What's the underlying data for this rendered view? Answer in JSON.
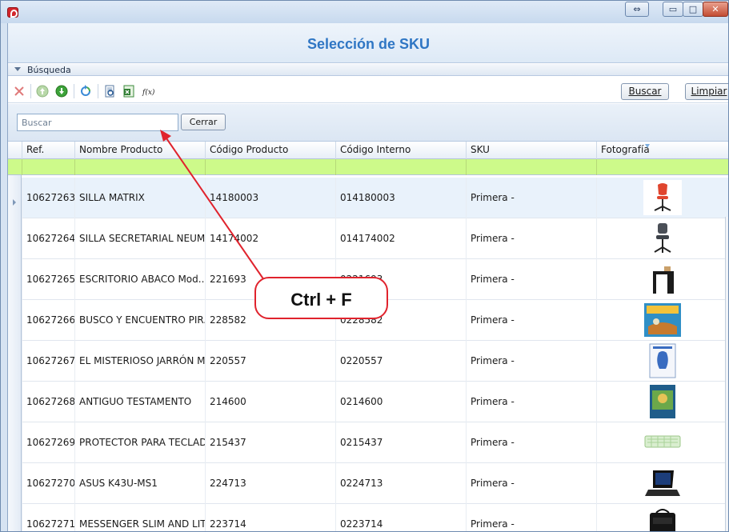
{
  "window": {
    "controls": {
      "restore_side": "⇔",
      "minimize": "▭",
      "maximize": "□",
      "close": "✕"
    }
  },
  "header": {
    "title": "Selección de SKU"
  },
  "search_group": {
    "label": "Búsqueda"
  },
  "toolbar": {
    "icons": [
      "delete-icon",
      "up-icon",
      "down-icon",
      "refresh-icon",
      "preview-icon",
      "export-excel-icon",
      "function-icon"
    ],
    "function_label": "f(x)",
    "buscar_label": "Buscar",
    "limpiar_label": "Limpiar"
  },
  "searchbar": {
    "placeholder": "Buscar",
    "value": "",
    "close_label": "Cerrar"
  },
  "grid": {
    "columns": [
      "Ref.",
      "Nombre Producto",
      "Código Producto",
      "Código Interno",
      "SKU",
      "Fotografía"
    ],
    "rows": [
      {
        "ref": "10627263",
        "nombre": "SILLA MATRIX",
        "codigo": "14180003",
        "interno": "014180003",
        "sku": "Primera -",
        "photo": "red-office-chair"
      },
      {
        "ref": "10627264",
        "nombre": "SILLA SECRETARIAL NEUM...",
        "codigo": "14174002",
        "interno": "014174002",
        "sku": "Primera -",
        "photo": "gray-office-chair"
      },
      {
        "ref": "10627265",
        "nombre": "ESCRITORIO ABACO Mod....",
        "codigo": "221693",
        "interno": "0221693",
        "sku": "Primera -",
        "photo": "black-desk"
      },
      {
        "ref": "10627266",
        "nombre": "BUSCO Y ENCUENTRO PIR...",
        "codigo": "228582",
        "interno": "0228582",
        "sku": "Primera -",
        "photo": "pirate-book"
      },
      {
        "ref": "10627267",
        "nombre": "EL MISTERIOSO JARRÓN M...",
        "codigo": "220557",
        "interno": "0220557",
        "sku": "Primera -",
        "photo": "vase-book"
      },
      {
        "ref": "10627268",
        "nombre": "ANTIGUO TESTAMENTO",
        "codigo": "214600",
        "interno": "0214600",
        "sku": "Primera -",
        "photo": "testament-book"
      },
      {
        "ref": "10627269",
        "nombre": "PROTECTOR PARA TECLAD...",
        "codigo": "215437",
        "interno": "0215437",
        "sku": "Primera -",
        "photo": "keyboard-protector"
      },
      {
        "ref": "10627270",
        "nombre": "ASUS K43U-MS1",
        "codigo": "224713",
        "interno": "0224713",
        "sku": "Primera -",
        "photo": "laptop"
      },
      {
        "ref": "10627271",
        "nombre": "MESSENGER SLIM AND LITE",
        "codigo": "223714",
        "interno": "0223714",
        "sku": "Primera -",
        "photo": "messenger-bag"
      }
    ]
  },
  "annotation": {
    "text": "Ctrl + F"
  },
  "colors": {
    "title": "#2f76c4",
    "filter_row": "#cdfa8a",
    "annotation": "#e0232d"
  }
}
